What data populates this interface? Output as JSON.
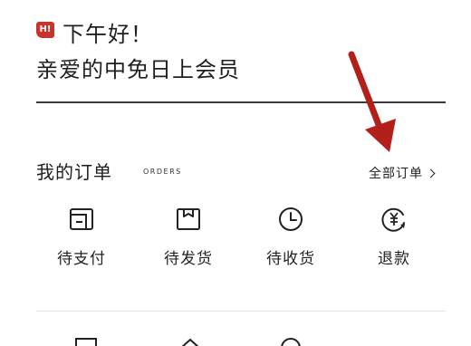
{
  "header": {
    "badge_text": "H!",
    "greeting": "下午好！",
    "member_line": "亲爱的中免日上会员"
  },
  "orders": {
    "title": "我的订单",
    "title_en": "ORDERS",
    "all_orders_label": "全部订单",
    "items": [
      {
        "label": "待支付",
        "icon": "wallet-icon"
      },
      {
        "label": "待发货",
        "icon": "package-icon"
      },
      {
        "label": "待收货",
        "icon": "clock-icon"
      },
      {
        "label": "退款",
        "icon": "refund-yen-icon"
      }
    ]
  },
  "colors": {
    "accent_red": "#c8342a",
    "annotation_arrow": "#b3201a",
    "text": "#1f1f1f"
  }
}
